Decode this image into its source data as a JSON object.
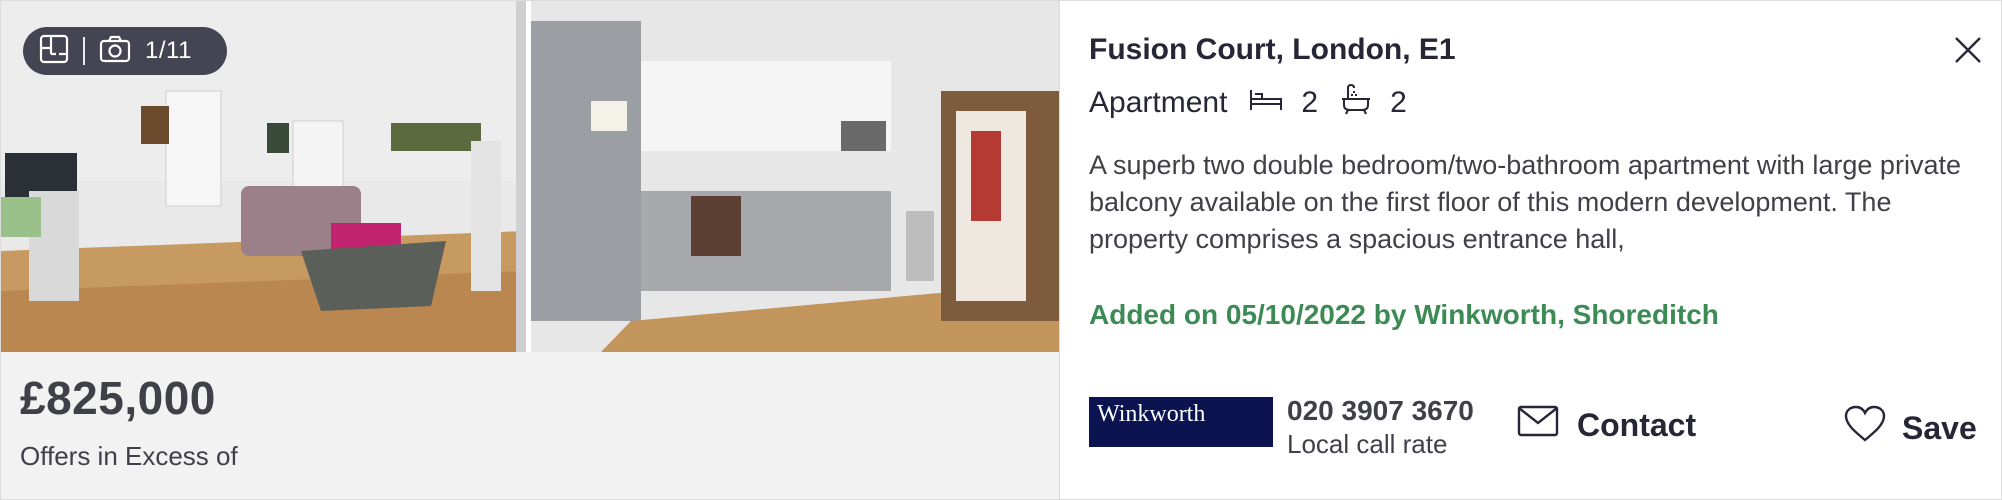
{
  "gallery": {
    "counter": "1/11",
    "icons": [
      "floorplan-icon",
      "camera-icon"
    ]
  },
  "listing": {
    "price": "£825,000",
    "price_qualifier": "Offers in Excess of",
    "address": "Fusion Court, London, E1",
    "property_type": "Apartment",
    "bedrooms": "2",
    "bathrooms": "2",
    "description": "A superb two double bedroom/two-bathroom apartment with large private balcony available on the first floor of this modern development. The property comprises a spacious entrance hall,",
    "added": "Added on 05/10/2022 by Winkworth, Shoreditch"
  },
  "agent": {
    "logo_text": "Winkworth",
    "phone": "020 3907 3670",
    "phone_note": "Local call rate"
  },
  "actions": {
    "contact_label": "Contact",
    "save_label": "Save"
  },
  "colors": {
    "added_text": "#3c8b55",
    "agent_logo_bg": "#0b1450",
    "price_panel_bg": "#f2f2f2"
  }
}
